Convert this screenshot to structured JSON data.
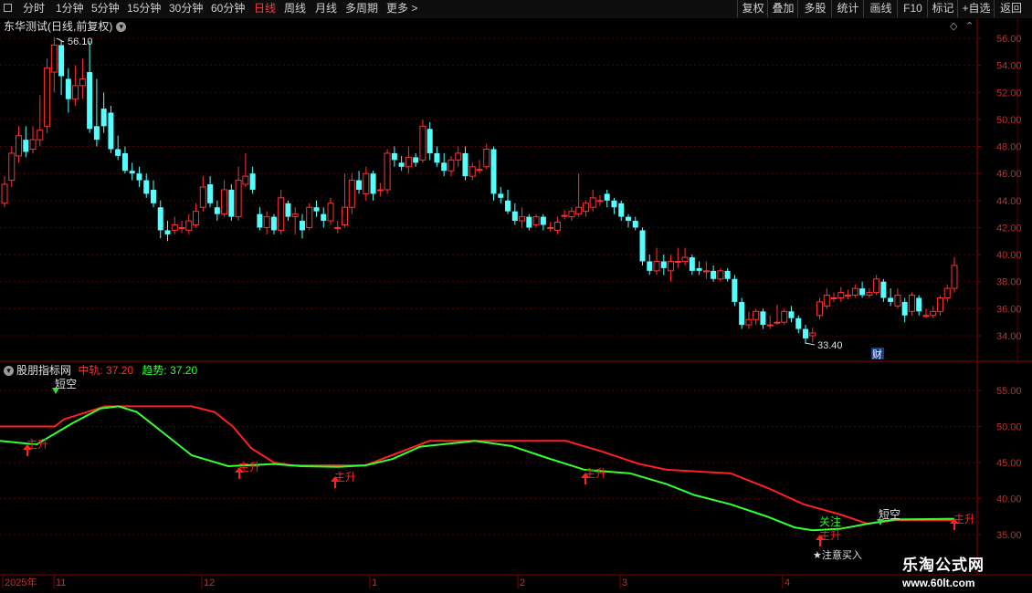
{
  "toolbar": {
    "left_items": [
      "分时",
      "1分钟",
      "5分钟",
      "15分钟",
      "30分钟",
      "60分钟",
      "日线",
      "周线",
      "月线",
      "多周期",
      "更多"
    ],
    "active_item": "日线",
    "more_arrow": ">",
    "right_buttons": [
      "复权",
      "叠加",
      "多股",
      "统计",
      "画线",
      "F10",
      "标记",
      "+自选",
      "返回"
    ]
  },
  "header": {
    "title": "东华测试(日线,前复权)",
    "dropdown_icon": "chevron-down-icon"
  },
  "price_chart": {
    "y_ticks": [
      "56.00",
      "54.00",
      "52.00",
      "50.00",
      "48.00",
      "46.00",
      "44.00",
      "42.00",
      "40.00",
      "38.00",
      "36.00",
      "34.00"
    ],
    "high_label": "56.10",
    "low_label": "33.40",
    "finance_badge": "财",
    "colors": {
      "up": "#ff3232",
      "down": "#54ffff",
      "grid": "#5a0000"
    }
  },
  "indicator": {
    "name": "股朋指标网",
    "mid_label": "中轨:",
    "mid_value": "37.20",
    "trend_label": "趋势:",
    "trend_value": "37.20",
    "y_ticks": [
      "55.00",
      "50.00",
      "45.00",
      "40.00",
      "35.00"
    ],
    "signals": {
      "short_empty": "短空",
      "main_rise": "主升",
      "watch": "关注",
      "note_buy": "★注意买入"
    },
    "colors": {
      "mid": "#ff2020",
      "trend": "#33ff33"
    }
  },
  "x_axis": {
    "labels": [
      "2025年",
      "11",
      "12",
      "1",
      "2",
      "3",
      "4"
    ]
  },
  "watermark": {
    "name": "乐淘公式网",
    "url": "www.60lt.com"
  },
  "chart_data": {
    "type": "candlestick",
    "ylim": [
      33,
      57
    ],
    "candles": [
      {
        "o": 43.8,
        "c": 45.2,
        "h": 45.8,
        "l": 43.5
      },
      {
        "o": 45.5,
        "c": 47.5,
        "h": 48.0,
        "l": 45.0
      },
      {
        "o": 47.3,
        "c": 48.8,
        "h": 49.5,
        "l": 46.8
      },
      {
        "o": 48.5,
        "c": 47.6,
        "h": 49.5,
        "l": 47.2
      },
      {
        "o": 47.8,
        "c": 48.5,
        "h": 49.5,
        "l": 47.5
      },
      {
        "o": 48.5,
        "c": 49.2,
        "h": 51.8,
        "l": 48.0
      },
      {
        "o": 49.5,
        "c": 53.8,
        "h": 54.5,
        "l": 49.0
      },
      {
        "o": 53.5,
        "c": 55.5,
        "h": 56.1,
        "l": 52.0
      },
      {
        "o": 55.5,
        "c": 53.2,
        "h": 55.8,
        "l": 51.8
      },
      {
        "o": 53.0,
        "c": 51.5,
        "h": 53.8,
        "l": 50.5
      },
      {
        "o": 51.5,
        "c": 52.5,
        "h": 54.0,
        "l": 51.0
      },
      {
        "o": 52.5,
        "c": 53.0,
        "h": 54.5,
        "l": 51.5
      },
      {
        "o": 53.5,
        "c": 49.3,
        "h": 55.8,
        "l": 49.0
      },
      {
        "o": 49.5,
        "c": 48.5,
        "h": 53.0,
        "l": 48.0
      },
      {
        "o": 50.8,
        "c": 49.5,
        "h": 52.0,
        "l": 49.0
      },
      {
        "o": 50.5,
        "c": 47.8,
        "h": 51.0,
        "l": 47.5
      },
      {
        "o": 47.8,
        "c": 47.3,
        "h": 48.8,
        "l": 47.0
      },
      {
        "o": 47.5,
        "c": 46.2,
        "h": 48.0,
        "l": 46.0
      },
      {
        "o": 46.2,
        "c": 46.0,
        "h": 46.8,
        "l": 45.5
      },
      {
        "o": 46.0,
        "c": 45.5,
        "h": 46.5,
        "l": 45.0
      },
      {
        "o": 45.5,
        "c": 44.5,
        "h": 46.0,
        "l": 44.2
      },
      {
        "o": 44.8,
        "c": 43.8,
        "h": 45.5,
        "l": 43.5
      },
      {
        "o": 43.5,
        "c": 41.8,
        "h": 44.0,
        "l": 41.2
      },
      {
        "o": 41.8,
        "c": 41.5,
        "h": 42.5,
        "l": 41.0
      },
      {
        "o": 41.8,
        "c": 42.2,
        "h": 42.8,
        "l": 41.5
      },
      {
        "o": 42.0,
        "c": 42.0,
        "h": 42.5,
        "l": 41.6
      },
      {
        "o": 41.8,
        "c": 42.5,
        "h": 43.0,
        "l": 41.5
      },
      {
        "o": 42.2,
        "c": 43.2,
        "h": 43.8,
        "l": 42.0
      },
      {
        "o": 43.5,
        "c": 45.0,
        "h": 45.8,
        "l": 43.2
      },
      {
        "o": 45.2,
        "c": 43.8,
        "h": 45.8,
        "l": 43.5
      },
      {
        "o": 43.5,
        "c": 43.0,
        "h": 44.0,
        "l": 42.5
      },
      {
        "o": 43.0,
        "c": 44.8,
        "h": 45.5,
        "l": 42.8
      },
      {
        "o": 44.8,
        "c": 42.8,
        "h": 45.2,
        "l": 42.5
      },
      {
        "o": 42.8,
        "c": 45.5,
        "h": 46.5,
        "l": 42.5
      },
      {
        "o": 45.2,
        "c": 45.8,
        "h": 47.5,
        "l": 45.0
      },
      {
        "o": 46.0,
        "c": 44.8,
        "h": 46.5,
        "l": 44.5
      },
      {
        "o": 43.0,
        "c": 42.0,
        "h": 43.5,
        "l": 41.8
      },
      {
        "o": 42.0,
        "c": 42.8,
        "h": 43.2,
        "l": 41.5
      },
      {
        "o": 42.8,
        "c": 41.8,
        "h": 43.0,
        "l": 41.5
      },
      {
        "o": 41.8,
        "c": 44.2,
        "h": 44.8,
        "l": 41.5
      },
      {
        "o": 43.8,
        "c": 42.8,
        "h": 44.0,
        "l": 42.5
      },
      {
        "o": 42.8,
        "c": 43.0,
        "h": 43.5,
        "l": 41.5
      },
      {
        "o": 42.5,
        "c": 41.8,
        "h": 43.0,
        "l": 41.2
      },
      {
        "o": 42.0,
        "c": 43.5,
        "h": 43.8,
        "l": 41.8
      },
      {
        "o": 43.5,
        "c": 43.2,
        "h": 44.0,
        "l": 42.8
      },
      {
        "o": 43.0,
        "c": 42.5,
        "h": 43.5,
        "l": 42.0
      },
      {
        "o": 42.5,
        "c": 43.8,
        "h": 44.2,
        "l": 42.2
      },
      {
        "o": 42.0,
        "c": 42.0,
        "h": 42.5,
        "l": 41.6
      },
      {
        "o": 42.2,
        "c": 43.5,
        "h": 46.0,
        "l": 42.0
      },
      {
        "o": 43.5,
        "c": 45.5,
        "h": 46.0,
        "l": 43.0
      },
      {
        "o": 45.5,
        "c": 44.8,
        "h": 46.2,
        "l": 44.5
      },
      {
        "o": 44.5,
        "c": 46.0,
        "h": 46.5,
        "l": 44.0
      },
      {
        "o": 46.0,
        "c": 44.5,
        "h": 46.2,
        "l": 44.0
      },
      {
        "o": 44.8,
        "c": 44.8,
        "h": 45.3,
        "l": 44.3
      },
      {
        "o": 44.8,
        "c": 47.5,
        "h": 47.8,
        "l": 44.5
      },
      {
        "o": 47.5,
        "c": 47.0,
        "h": 48.0,
        "l": 46.5
      },
      {
        "o": 46.8,
        "c": 46.5,
        "h": 47.3,
        "l": 46.2
      },
      {
        "o": 46.5,
        "c": 47.2,
        "h": 48.0,
        "l": 46.0
      },
      {
        "o": 47.2,
        "c": 46.8,
        "h": 47.5,
        "l": 46.5
      },
      {
        "o": 47.0,
        "c": 49.5,
        "h": 50.0,
        "l": 46.8
      },
      {
        "o": 49.3,
        "c": 47.5,
        "h": 49.8,
        "l": 47.0
      },
      {
        "o": 47.5,
        "c": 46.8,
        "h": 48.0,
        "l": 46.5
      },
      {
        "o": 46.8,
        "c": 46.2,
        "h": 47.5,
        "l": 45.8
      },
      {
        "o": 46.2,
        "c": 47.0,
        "h": 47.3,
        "l": 45.8
      },
      {
        "o": 47.0,
        "c": 47.5,
        "h": 48.0,
        "l": 46.5
      },
      {
        "o": 47.5,
        "c": 45.8,
        "h": 48.0,
        "l": 45.5
      },
      {
        "o": 45.8,
        "c": 46.5,
        "h": 46.8,
        "l": 45.5
      },
      {
        "o": 46.3,
        "c": 46.3,
        "h": 47.0,
        "l": 46.0
      },
      {
        "o": 46.5,
        "c": 47.8,
        "h": 48.2,
        "l": 46.3
      },
      {
        "o": 47.8,
        "c": 44.5,
        "h": 48.0,
        "l": 44.0
      },
      {
        "o": 44.5,
        "c": 44.2,
        "h": 45.0,
        "l": 43.8
      },
      {
        "o": 44.0,
        "c": 43.2,
        "h": 44.8,
        "l": 43.0
      },
      {
        "o": 43.2,
        "c": 42.5,
        "h": 43.8,
        "l": 42.2
      },
      {
        "o": 42.5,
        "c": 42.8,
        "h": 43.5,
        "l": 42.0
      },
      {
        "o": 42.8,
        "c": 42.0,
        "h": 43.0,
        "l": 41.8
      },
      {
        "o": 42.2,
        "c": 42.8,
        "h": 43.0,
        "l": 42.0
      },
      {
        "o": 42.8,
        "c": 42.2,
        "h": 43.0,
        "l": 41.8
      },
      {
        "o": 42.0,
        "c": 42.0,
        "h": 42.4,
        "l": 41.7
      },
      {
        "o": 41.8,
        "c": 42.4,
        "h": 42.8,
        "l": 41.5
      },
      {
        "o": 42.9,
        "c": 42.9,
        "h": 43.3,
        "l": 42.6
      },
      {
        "o": 42.8,
        "c": 43.2,
        "h": 43.5,
        "l": 42.5
      },
      {
        "o": 43.0,
        "c": 43.5,
        "h": 46.0,
        "l": 42.8
      },
      {
        "o": 43.2,
        "c": 43.8,
        "h": 44.0,
        "l": 42.8
      },
      {
        "o": 43.5,
        "c": 44.2,
        "h": 44.8,
        "l": 43.2
      },
      {
        "o": 44.0,
        "c": 44.0,
        "h": 44.4,
        "l": 43.6
      },
      {
        "o": 44.5,
        "c": 44.0,
        "h": 44.8,
        "l": 43.5
      },
      {
        "o": 44.0,
        "c": 43.5,
        "h": 44.2,
        "l": 43.0
      },
      {
        "o": 43.8,
        "c": 42.8,
        "h": 44.0,
        "l": 42.5
      },
      {
        "o": 42.8,
        "c": 42.5,
        "h": 43.0,
        "l": 42.0
      },
      {
        "o": 42.5,
        "c": 42.0,
        "h": 42.8,
        "l": 41.8
      },
      {
        "o": 41.8,
        "c": 39.5,
        "h": 42.0,
        "l": 39.2
      },
      {
        "o": 39.5,
        "c": 38.8,
        "h": 40.0,
        "l": 38.5
      },
      {
        "o": 38.8,
        "c": 39.5,
        "h": 40.5,
        "l": 38.5
      },
      {
        "o": 39.5,
        "c": 39.0,
        "h": 40.0,
        "l": 38.5
      },
      {
        "o": 38.8,
        "c": 39.5,
        "h": 40.0,
        "l": 38.0
      },
      {
        "o": 39.5,
        "c": 39.5,
        "h": 40.5,
        "l": 39.0
      },
      {
        "o": 39.5,
        "c": 39.8,
        "h": 40.5,
        "l": 39.2
      },
      {
        "o": 39.8,
        "c": 38.8,
        "h": 40.0,
        "l": 38.5
      },
      {
        "o": 39.0,
        "c": 38.8,
        "h": 39.5,
        "l": 38.5
      },
      {
        "o": 38.8,
        "c": 38.8,
        "h": 39.5,
        "l": 38.2
      },
      {
        "o": 38.8,
        "c": 38.2,
        "h": 39.2,
        "l": 38.0
      },
      {
        "o": 38.2,
        "c": 38.8,
        "h": 39.0,
        "l": 38.0
      },
      {
        "o": 38.8,
        "c": 38.2,
        "h": 39.0,
        "l": 38.0
      },
      {
        "o": 38.2,
        "c": 36.5,
        "h": 38.5,
        "l": 36.2
      },
      {
        "o": 36.5,
        "c": 34.8,
        "h": 36.8,
        "l": 34.5
      },
      {
        "o": 34.8,
        "c": 35.2,
        "h": 35.8,
        "l": 34.5
      },
      {
        "o": 35.2,
        "c": 35.8,
        "h": 36.0,
        "l": 34.8
      },
      {
        "o": 35.8,
        "c": 34.8,
        "h": 36.0,
        "l": 34.5
      },
      {
        "o": 34.8,
        "c": 34.8,
        "h": 35.5,
        "l": 34.5
      },
      {
        "o": 35.0,
        "c": 35.0,
        "h": 36.3,
        "l": 34.8
      },
      {
        "o": 35.0,
        "c": 35.8,
        "h": 36.0,
        "l": 34.8
      },
      {
        "o": 35.8,
        "c": 35.3,
        "h": 36.2,
        "l": 35.0
      },
      {
        "o": 35.3,
        "c": 34.5,
        "h": 35.5,
        "l": 34.2
      },
      {
        "o": 34.5,
        "c": 33.8,
        "h": 34.8,
        "l": 33.4
      },
      {
        "o": 34.0,
        "c": 34.2,
        "h": 34.6,
        "l": 33.5
      },
      {
        "o": 35.5,
        "c": 36.5,
        "h": 36.8,
        "l": 35.2
      },
      {
        "o": 36.2,
        "c": 37.0,
        "h": 37.5,
        "l": 36.0
      },
      {
        "o": 36.8,
        "c": 36.8,
        "h": 37.2,
        "l": 36.5
      },
      {
        "o": 36.8,
        "c": 37.2,
        "h": 37.6,
        "l": 36.5
      },
      {
        "o": 37.0,
        "c": 37.0,
        "h": 37.4,
        "l": 36.7
      },
      {
        "o": 37.0,
        "c": 37.5,
        "h": 37.8,
        "l": 36.8
      },
      {
        "o": 37.5,
        "c": 37.0,
        "h": 38.0,
        "l": 36.8
      },
      {
        "o": 37.0,
        "c": 37.2,
        "h": 37.5,
        "l": 36.8
      },
      {
        "o": 37.2,
        "c": 38.2,
        "h": 38.5,
        "l": 37.0
      },
      {
        "o": 38.0,
        "c": 36.8,
        "h": 38.2,
        "l": 36.5
      },
      {
        "o": 36.8,
        "c": 36.5,
        "h": 37.5,
        "l": 36.2
      },
      {
        "o": 36.2,
        "c": 37.0,
        "h": 37.5,
        "l": 36.0
      },
      {
        "o": 36.5,
        "c": 35.5,
        "h": 36.8,
        "l": 35.0
      },
      {
        "o": 35.8,
        "c": 37.0,
        "h": 37.2,
        "l": 35.5
      },
      {
        "o": 36.8,
        "c": 35.8,
        "h": 37.0,
        "l": 35.5
      },
      {
        "o": 35.5,
        "c": 35.5,
        "h": 36.0,
        "l": 35.3
      },
      {
        "o": 35.5,
        "c": 35.8,
        "h": 36.2,
        "l": 35.3
      },
      {
        "o": 35.8,
        "c": 36.8,
        "h": 37.0,
        "l": 35.5
      },
      {
        "o": 36.8,
        "c": 37.5,
        "h": 37.8,
        "l": 36.5
      },
      {
        "o": 37.5,
        "c": 39.2,
        "h": 39.8,
        "l": 37.2
      }
    ],
    "indicator_ylim": [
      32.5,
      57.5
    ],
    "mid_line": [
      [
        0,
        50.0
      ],
      [
        60,
        50.0
      ],
      [
        70,
        51.0
      ],
      [
        115,
        52.8
      ],
      [
        160,
        52.8
      ],
      [
        210,
        52.8
      ],
      [
        235,
        52.0
      ],
      [
        255,
        50.0
      ],
      [
        275,
        47.0
      ],
      [
        300,
        45.0
      ],
      [
        320,
        44.6
      ],
      [
        400,
        44.6
      ],
      [
        470,
        48.0
      ],
      [
        620,
        48.0
      ],
      [
        660,
        46.5
      ],
      [
        700,
        44.8
      ],
      [
        730,
        44.0
      ],
      [
        800,
        43.5
      ],
      [
        840,
        41.5
      ],
      [
        880,
        39.2
      ],
      [
        920,
        37.8
      ],
      [
        950,
        36.5
      ],
      [
        980,
        37.0
      ],
      [
        1045,
        37.0
      ]
    ],
    "trend_line": [
      [
        0,
        48.0
      ],
      [
        40,
        47.5
      ],
      [
        80,
        50.5
      ],
      [
        110,
        52.5
      ],
      [
        130,
        52.8
      ],
      [
        150,
        52.0
      ],
      [
        180,
        49.0
      ],
      [
        210,
        46.0
      ],
      [
        250,
        44.5
      ],
      [
        300,
        44.8
      ],
      [
        330,
        44.5
      ],
      [
        370,
        44.4
      ],
      [
        400,
        44.6
      ],
      [
        430,
        45.5
      ],
      [
        460,
        47.2
      ],
      [
        520,
        48.0
      ],
      [
        560,
        47.3
      ],
      [
        600,
        45.6
      ],
      [
        640,
        44.0
      ],
      [
        690,
        43.5
      ],
      [
        730,
        42.0
      ],
      [
        760,
        40.5
      ],
      [
        800,
        39.2
      ],
      [
        840,
        37.5
      ],
      [
        870,
        36.0
      ],
      [
        890,
        35.6
      ],
      [
        920,
        35.8
      ],
      [
        950,
        36.5
      ],
      [
        980,
        37.1
      ],
      [
        1045,
        37.2
      ]
    ]
  }
}
